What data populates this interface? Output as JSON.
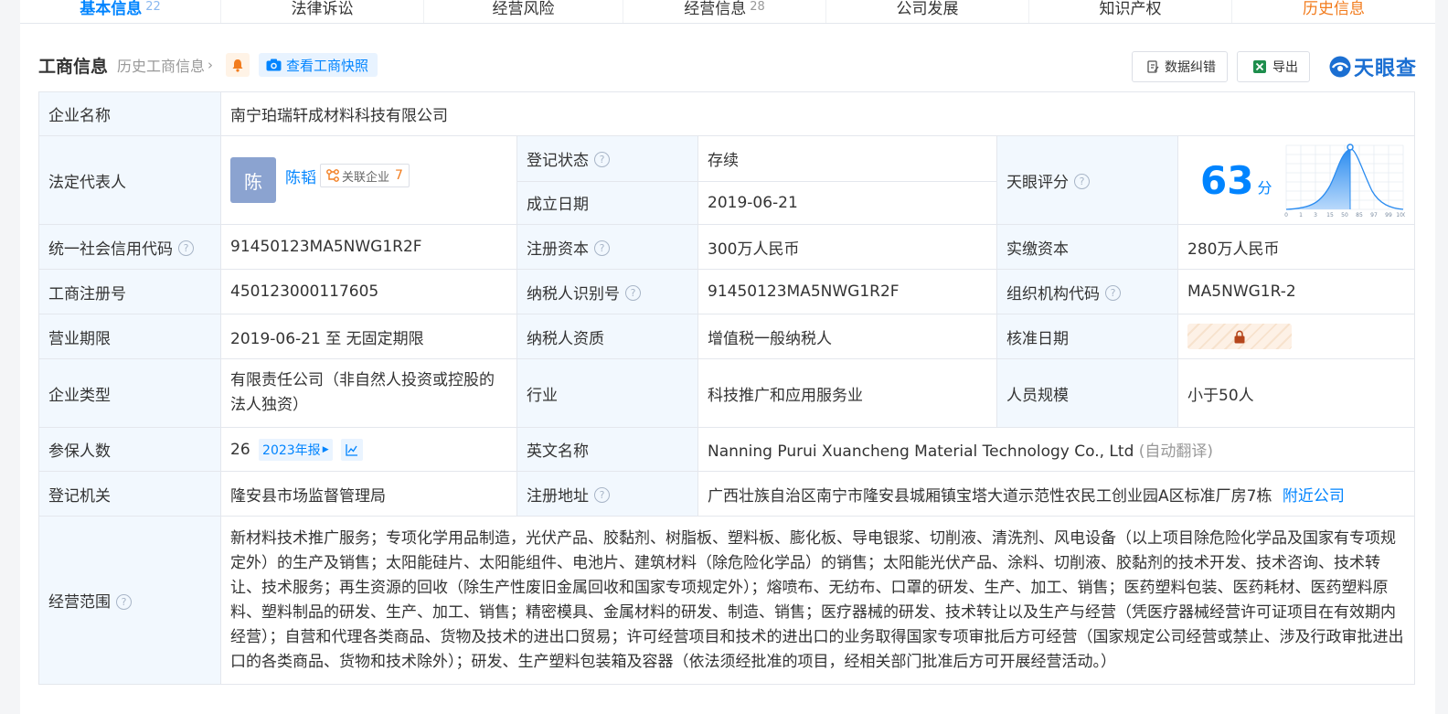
{
  "tabs": [
    {
      "label": "基本信息",
      "count": "22",
      "state": "active"
    },
    {
      "label": "法律诉讼",
      "count": "",
      "state": "normal"
    },
    {
      "label": "经营风险",
      "count": "",
      "state": "normal"
    },
    {
      "label": "经营信息",
      "count": "28",
      "state": "normal"
    },
    {
      "label": "公司发展",
      "count": "",
      "state": "normal"
    },
    {
      "label": "知识产权",
      "count": "",
      "state": "normal"
    },
    {
      "label": "历史信息",
      "count": "",
      "state": "orange"
    }
  ],
  "header": {
    "title": "工商信息",
    "history_link": "历史工商信息",
    "snapshot_label": "查看工商快照",
    "correction_label": "数据纠错",
    "export_label": "导出",
    "logo_text": "天眼查"
  },
  "colors": {
    "accent": "#0084ff",
    "label_bg": "#f2f8fe",
    "status_green": "#1aa34a",
    "orange": "#f27c1e"
  },
  "info": {
    "company_name_label": "企业名称",
    "company_name": "南宁珀瑞轩成材料科技有限公司",
    "legal_rep_label": "法定代表人",
    "legal_rep_avatar": "陈",
    "legal_rep_name": "陈韬",
    "related_label": "关联企业",
    "related_count": "7",
    "reg_status_label": "登记状态",
    "reg_status": "存续",
    "found_date_label": "成立日期",
    "found_date": "2019-06-21",
    "score_label": "天眼评分",
    "score": "63",
    "score_unit": "分",
    "score_ticks": [
      "0",
      "1",
      "3",
      "15",
      "50",
      "85",
      "97",
      "99",
      "100"
    ],
    "credit_code_label": "统一社会信用代码",
    "credit_code": "91450123MA5NWG1R2F",
    "reg_capital_label": "注册资本",
    "reg_capital": "300万人民币",
    "paid_capital_label": "实缴资本",
    "paid_capital": "280万人民币",
    "reg_no_label": "工商注册号",
    "reg_no": "450123000117605",
    "taxpayer_id_label": "纳税人识别号",
    "taxpayer_id": "91450123MA5NWG1R2F",
    "org_code_label": "组织机构代码",
    "org_code": "MA5NWG1R-2",
    "term_label": "营业期限",
    "term": "2019-06-21 至 无固定期限",
    "taxpayer_qual_label": "纳税人资质",
    "taxpayer_qual": "增值税一般纳税人",
    "approve_date_label": "核准日期",
    "type_label": "企业类型",
    "type": "有限责任公司（非自然人投资或控股的法人独资）",
    "industry_label": "行业",
    "industry": "科技推广和应用服务业",
    "staff_label": "人员规模",
    "staff": "小于50人",
    "insured_label": "参保人数",
    "insured": "26",
    "insured_year": "2023年报",
    "en_name_label": "英文名称",
    "en_name": "Nanning Purui Xuancheng Material Technology Co., Ltd",
    "en_name_note": "(自动翻译)",
    "authority_label": "登记机关",
    "authority": "隆安县市场监督管理局",
    "address_label": "注册地址",
    "address": "广西壮族自治区南宁市隆安县城厢镇宝塔大道示范性农民工创业园A区标准厂房7栋",
    "nearby_label": "附近公司",
    "scope_label": "经营范围",
    "scope": "新材料技术推广服务；专项化学用品制造，光伏产品、胶黏剂、树脂板、塑料板、膨化板、导电银浆、切削液、清洗剂、风电设备（以上项目除危险化学品及国家有专项规定外）的生产及销售；太阳能硅片、太阳能组件、电池片、建筑材料（除危险化学品）的销售；太阳能光伏产品、涂料、切削液、胶黏剂的技术开发、技术咨询、技术转让、技术服务；再生资源的回收（除生产性废旧金属回收和国家专项规定外）；熔喷布、无纺布、口罩的研发、生产、加工、销售；医药塑料包装、医药耗材、医药塑料原料、塑料制品的研发、生产、加工、销售；精密模具、金属材料的研发、制造、销售；医疗器械的研发、技术转让以及生产与经营（凭医疗器械经营许可证项目在有效期内经营）；自营和代理各类商品、货物及技术的进出口贸易；许可经营项目和技术的进出口的业务取得国家专项审批后方可经营（国家规定公司经营或禁止、涉及行政审批进出口的各类商品、货物和技术除外）；研发、生产塑料包装箱及容器（依法须经批准的项目，经相关部门批准后方可开展经营活动。）"
  }
}
